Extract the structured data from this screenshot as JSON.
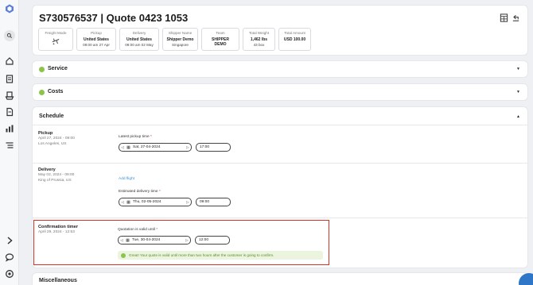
{
  "header": {
    "title": "S730576537 | Quote 0423 1053",
    "metrics": [
      {
        "label": "Freight Mode",
        "value": "",
        "sub": ""
      },
      {
        "label": "Pickup",
        "value": "United States",
        "sub": "09:00 am 27 Apr"
      },
      {
        "label": "Delivery",
        "value": "United States",
        "sub": "09:00 am 02 May"
      },
      {
        "label": "Shipper Name",
        "value": "Shipper Demo",
        "sub": "Singapore"
      },
      {
        "label": "Team",
        "value": "SHIPPER DEMO",
        "sub": ""
      },
      {
        "label": "Total Weight",
        "value": "1,462 lbs",
        "sub": "43 box"
      },
      {
        "label": "Total Amount",
        "value": "USD 100.00",
        "sub": ""
      }
    ]
  },
  "sections": {
    "service": "Service",
    "costs": "Costs",
    "schedule": "Schedule",
    "misc": "Miscellaneous"
  },
  "pickup": {
    "title": "Pickup",
    "date": "April 27, 2024 - 09:00",
    "location": "Los Angeles, US",
    "field_label": "Latest pickup time",
    "req": "*",
    "date_value": "Sat, 27-04-2024",
    "time_value": "17:00"
  },
  "delivery": {
    "title": "Delivery",
    "date": "May 02, 2024 - 09:00",
    "location": "King of Prussia, US",
    "add_flight": "Add flight",
    "field_label": "Estimated delivery time",
    "req": "*",
    "date_value": "Thu, 02-05-2024",
    "time_value": "09:00"
  },
  "confirmation": {
    "title": "Confirmation timer",
    "date": "April 29, 2024 - 12:53",
    "field_label": "Quotation is valid until",
    "req": "*",
    "date_value": "Tue, 30-04-2024",
    "time_value": "12:00",
    "alert": "Great! Your quote is valid until more than two hours after the customer is going to confirm."
  },
  "colors": {
    "accent": "#3a8fd8",
    "success": "#8cc34a",
    "error": "#d93025"
  },
  "icons": {
    "rail": [
      "logo-icon",
      "search-icon",
      "home-icon",
      "clipboard-icon",
      "ship-icon",
      "document-icon",
      "chart-icon",
      "list-icon",
      "chevron-right-icon",
      "chat-icon",
      "settings-icon"
    ],
    "header": [
      "calculator-icon",
      "undo-icon"
    ]
  }
}
